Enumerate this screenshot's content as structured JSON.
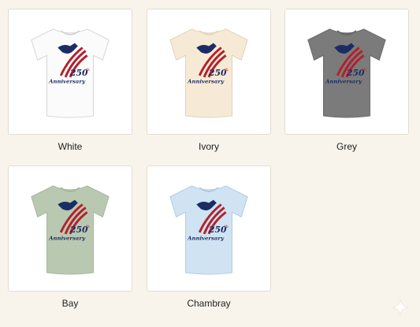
{
  "swatches": [
    {
      "label": "White",
      "color": "#fbfbfb",
      "icon": "tshirt-icon"
    },
    {
      "label": "Ivory",
      "color": "#f6ead6",
      "icon": "tshirt-icon"
    },
    {
      "label": "Grey",
      "color": "#7b7b7b",
      "icon": "tshirt-icon"
    },
    {
      "label": "Bay",
      "color": "#b9c8b0",
      "icon": "tshirt-icon"
    },
    {
      "label": "Chambray",
      "color": "#cfe3f3",
      "icon": "tshirt-icon"
    }
  ],
  "design": {
    "number": "250",
    "suffix": "th",
    "word": "Anniversary",
    "colors": {
      "navy": "#1b2d63",
      "red": "#b3202c"
    }
  },
  "accent_icon": "sparkle-icon"
}
